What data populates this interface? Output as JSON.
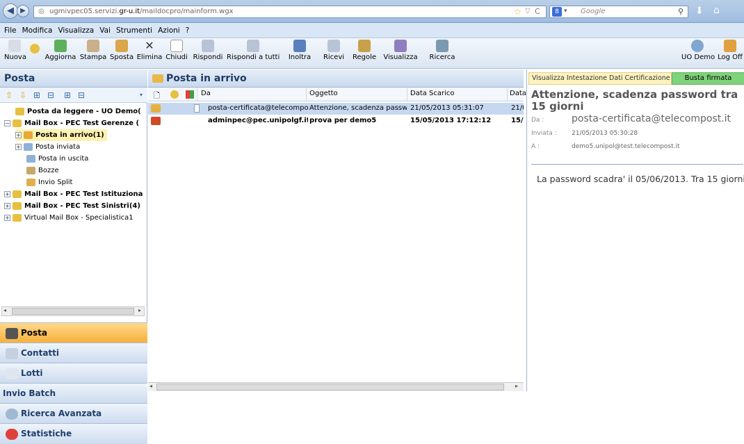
{
  "browser": {
    "url_prefix": "ugmivpec05.servizi.",
    "url_domain": "gr-u.it",
    "url_path": "/maildocpro/mainform.wgx",
    "search_placeholder": "Google"
  },
  "menu": [
    "File",
    "Modifica",
    "Visualizza",
    "Vai",
    "Strumenti",
    "Azioni",
    "?"
  ],
  "toolbar": {
    "nuova": "Nuova",
    "aggiorna": "Aggiorna",
    "stampa": "Stampa",
    "sposta": "Sposta",
    "elimina": "Elimina",
    "chiudi": "Chiudi",
    "rispondi": "Rispondi",
    "rispondi_tutti": "Rispondi a tutti",
    "inoltra": "Inoltra",
    "ricevi": "Ricevi",
    "regole": "Regole",
    "visualizza": "Visualizza",
    "ricerca": "Ricerca",
    "uo_demo": "UO Demo",
    "log_off": "Log Off"
  },
  "left": {
    "title": "Posta",
    "tree": [
      {
        "label": "Posta da leggere - UO Demo("
      },
      {
        "label": "Mail Box - PEC Test Gerenze ("
      },
      {
        "label": "Posta in arrivo(1)"
      },
      {
        "label": "Posta inviata"
      },
      {
        "label": "Posta in uscita"
      },
      {
        "label": "Bozze"
      },
      {
        "label": "Invio Split"
      },
      {
        "label": "Mail Box - PEC Test Istituziona"
      },
      {
        "label": "Mail Box - PEC Test Sinistri(4)"
      },
      {
        "label": "Virtual Mail Box - Specialistica1"
      }
    ],
    "accordion": [
      "Posta",
      "Contatti",
      "Lotti",
      "Invio Batch",
      "Ricerca Avanzata",
      "Statistiche"
    ]
  },
  "middle": {
    "title": "Posta in arrivo",
    "columns": [
      "Da",
      "Oggetto",
      "Data Scarico",
      "Data"
    ],
    "rows": [
      {
        "da": "posta-certificata@telecompost",
        "oggetto": "Attenzione, scadenza passwor",
        "data_scarico": "21/05/2013 05:31:07",
        "data": "21/0"
      },
      {
        "da": "adminpec@pec.unipolgf.it",
        "oggetto": "prova per demo5",
        "data_scarico": "15/05/2013 17:12:12",
        "data": "15/"
      }
    ]
  },
  "right": {
    "cert_link": "Visualizza Intestazione Dati Certificazione",
    "firmata": "Busta firmata",
    "subject": "Attenzione, scadenza password tra 15 giorni",
    "da_label": "Da :",
    "da_value": "posta-certificata@telecompost.it",
    "inviata_label": "Inviata :",
    "inviata_value": "21/05/2013 05:30:28",
    "a_label": "A :",
    "a_value": "demo5.unipol@test.telecompost.it",
    "body": "La password scadra' il 05/06/2013. Tra 15 giorni."
  }
}
